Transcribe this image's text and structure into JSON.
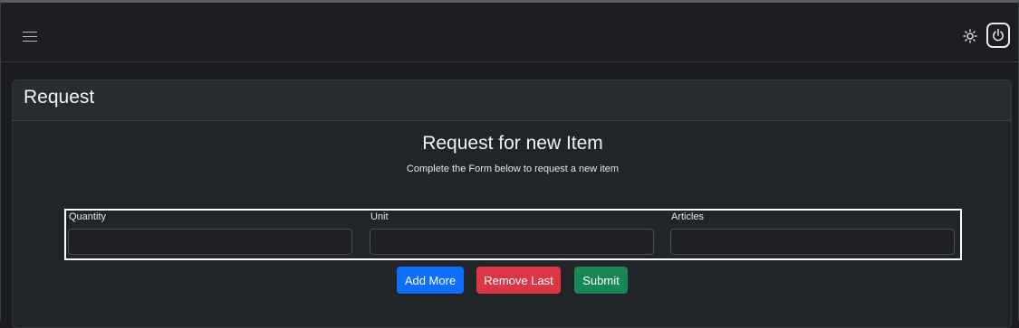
{
  "header": {
    "menu_icon": "hamburger-menu-icon",
    "theme_icon": "sun-icon",
    "power_icon": "power-icon"
  },
  "card": {
    "title": "Request"
  },
  "form": {
    "title": "Request for new Item",
    "subtitle": "Complete the Form below to request a new item",
    "fields": [
      {
        "label": "Quantity",
        "value": "",
        "placeholder": ""
      },
      {
        "label": "Unit",
        "value": "",
        "placeholder": ""
      },
      {
        "label": "Articles",
        "value": "",
        "placeholder": ""
      }
    ],
    "buttons": {
      "add_more": "Add More",
      "remove_last": "Remove Last",
      "submit": "Submit"
    }
  },
  "colors": {
    "primary": "#0d6efd",
    "danger": "#dc3545",
    "success": "#198754",
    "background": "#1b1d20",
    "card": "#212428"
  }
}
